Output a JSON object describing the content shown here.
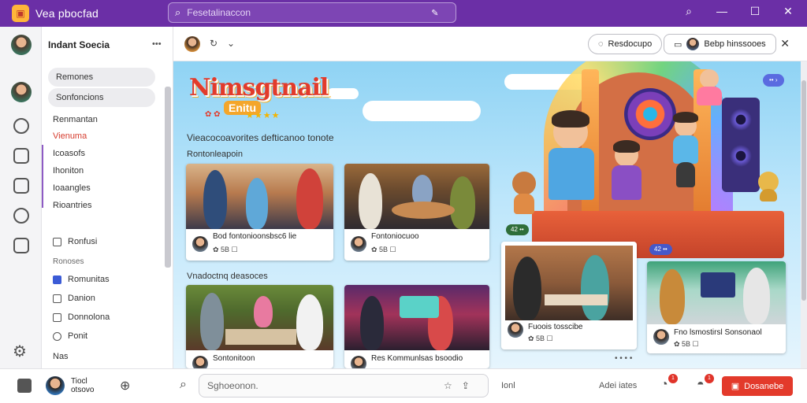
{
  "app": {
    "title": "Vea pbocfad",
    "search_placeholder": "Fesetalinaccon",
    "logo_icon": "app-logo-icon"
  },
  "sidebar": {
    "header": "Indant Soecia",
    "header_more": "•••",
    "pills": [
      "Remones",
      "Sonfoncions"
    ],
    "items": [
      {
        "label": "Renmantan",
        "active": false
      },
      {
        "label": "Vienuma",
        "active": true
      },
      {
        "label": "Icoasofs",
        "active": false
      },
      {
        "label": "Ihoniton",
        "active": false
      },
      {
        "label": "Ioaangles",
        "active": false
      },
      {
        "label": "Rioantries",
        "active": false
      }
    ],
    "small_top": "Ronfusi",
    "section_label": "Ronoses",
    "small_items": [
      {
        "label": "Romunitas",
        "icon": "blue"
      },
      {
        "label": "Danion",
        "icon": "box"
      },
      {
        "label": "Donnolona",
        "icon": "box"
      },
      {
        "label": "Ponit",
        "icon": "box"
      }
    ],
    "bottom_label": "Nas"
  },
  "toolbar": {
    "btn1": "Resdocupo",
    "btn2": "Bebp hinssooes",
    "close": "✕"
  },
  "main": {
    "logo_title": "Nimsgtnail",
    "logo_sub": "Enitu",
    "logo_stars": "★★★★",
    "logo_leaves": "✿ ✿",
    "tagline": "Vieacocoavorites defticanoo tonote",
    "section1": "Rontonleapoin",
    "section2": "Vnadoctnq deasoces",
    "badge_top": "•• ›",
    "badge_mid": "42 ••",
    "badge_right": "42 ••",
    "dots": "• • • •"
  },
  "cards": [
    {
      "title": "Bod fontonioonsbsc6 lie",
      "meta": "✿ 5B ☐"
    },
    {
      "title": "Fontoniocuoo",
      "meta": "✿ 5B ☐"
    },
    {
      "title": "Sontonitoon",
      "meta": "✿ 5B ☐"
    },
    {
      "title": "Res Kommunlsas bsoodio",
      "meta": "✿ 5B ☐"
    },
    {
      "title": "Fuoois tosscibe",
      "meta": "✿ 5B ☐"
    },
    {
      "title": "Fno lsmostirsl Sonsonaol",
      "meta": "✿ 5B ☐"
    }
  ],
  "bottombar": {
    "user_name": "Tiocl otsovo",
    "search_placeholder": "Sghoeonon.",
    "meta_text": "Ionl",
    "right_text": "Adei iates",
    "notif1": "1",
    "notif2": "1",
    "cta": "Dosanebe"
  },
  "colors": {
    "titlebar": "#6b2fa6",
    "accent_red": "#e33a2b",
    "active_item": "#d63c2e"
  }
}
